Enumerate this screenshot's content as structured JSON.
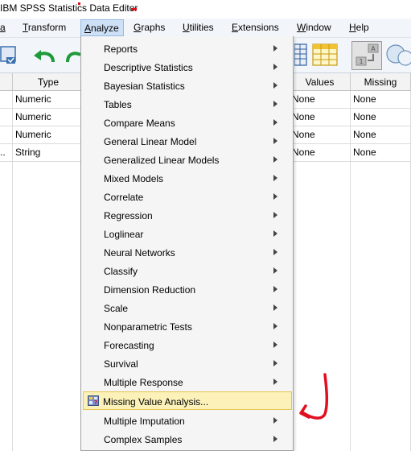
{
  "window": {
    "title": "IBM SPSS Statistics Data Editor"
  },
  "menubar": {
    "items": [
      {
        "label": "a"
      },
      {
        "label": "Transform"
      },
      {
        "label": "Analyze"
      },
      {
        "label": "Graphs"
      },
      {
        "label": "Utilities"
      },
      {
        "label": "Extensions"
      },
      {
        "label": "Window"
      },
      {
        "label": "Help"
      }
    ]
  },
  "grid": {
    "headers": {
      "type": "Type",
      "values": "Values",
      "missing": "Missing"
    },
    "rows": [
      {
        "type": "Numeric",
        "values": "None",
        "missing": "None"
      },
      {
        "type": "Numeric",
        "values": "None",
        "missing": "None"
      },
      {
        "type": "Numeric",
        "values": "None",
        "missing": "None"
      },
      {
        "lead": "..",
        "type": "String",
        "values": "None",
        "missing": "None"
      }
    ]
  },
  "analyze_menu": {
    "items": [
      {
        "label": "Reports",
        "submenu": true
      },
      {
        "label": "Descriptive Statistics",
        "submenu": true
      },
      {
        "label": "Bayesian Statistics",
        "submenu": true
      },
      {
        "label": "Tables",
        "submenu": true
      },
      {
        "label": "Compare Means",
        "submenu": true
      },
      {
        "label": "General Linear Model",
        "submenu": true
      },
      {
        "label": "Generalized Linear Models",
        "submenu": true
      },
      {
        "label": "Mixed Models",
        "submenu": true
      },
      {
        "label": "Correlate",
        "submenu": true
      },
      {
        "label": "Regression",
        "submenu": true
      },
      {
        "label": "Loglinear",
        "submenu": true
      },
      {
        "label": "Neural Networks",
        "submenu": true
      },
      {
        "label": "Classify",
        "submenu": true
      },
      {
        "label": "Dimension Reduction",
        "submenu": true
      },
      {
        "label": "Scale",
        "submenu": true
      },
      {
        "label": "Nonparametric Tests",
        "submenu": true
      },
      {
        "label": "Forecasting",
        "submenu": true
      },
      {
        "label": "Survival",
        "submenu": true
      },
      {
        "label": "Multiple Response",
        "submenu": true
      },
      {
        "label": "Missing Value Analysis...",
        "submenu": false,
        "highlighted": true,
        "icon": "missing-value-analysis-icon"
      },
      {
        "label": "Multiple Imputation",
        "submenu": true
      },
      {
        "label": "Complex Samples",
        "submenu": true
      }
    ]
  },
  "colors": {
    "annotation": "#e01020",
    "highlight": "#fbf1b9",
    "menu_active": "#cde0f6"
  },
  "icons": [
    "data-editor-icon",
    "undo-icon",
    "redo-icon",
    "grid-icon",
    "value-labels-icon",
    "circles-icon",
    "submenu-arrow-icon",
    "annotation-arrow-icon"
  ]
}
